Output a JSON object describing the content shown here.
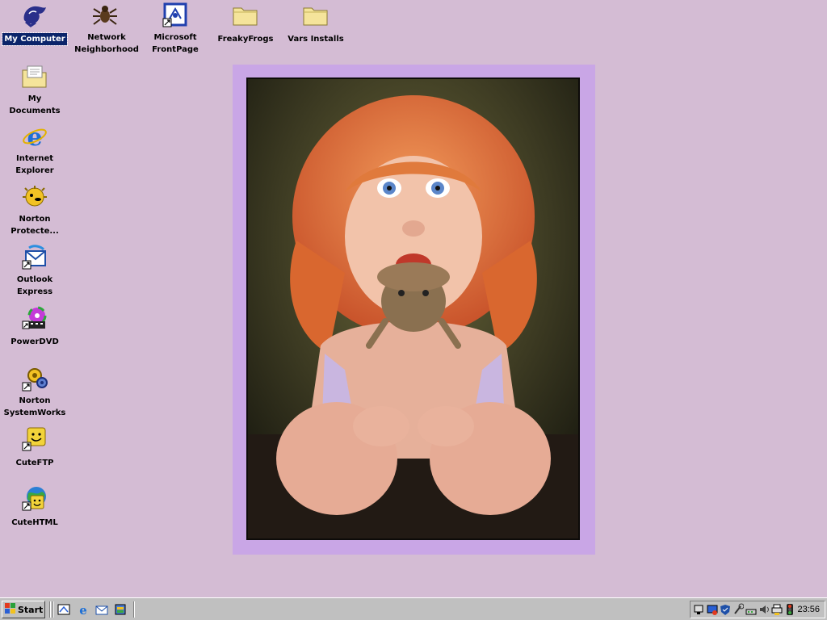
{
  "desktop": {
    "background": "#D4BCD4",
    "icons": [
      {
        "label": "My Computer",
        "icon": "my-computer-icon",
        "selected": true
      },
      {
        "label": "Network Neighborhood",
        "icon": "network-neighborhood-icon"
      },
      {
        "label": "Microsoft FrontPage",
        "icon": "frontpage-icon"
      },
      {
        "label": "FreakyFrogs",
        "icon": "folder-icon"
      },
      {
        "label": "Vars Installs",
        "icon": "folder-icon"
      },
      {
        "label": "My Documents",
        "icon": "my-documents-icon"
      },
      {
        "label": "Internet Explorer",
        "icon": "internet-explorer-icon"
      },
      {
        "label": "Norton Protecte...",
        "icon": "norton-protected-icon"
      },
      {
        "label": "Outlook Express",
        "icon": "outlook-express-icon"
      },
      {
        "label": "PowerDVD",
        "icon": "powerdvd-icon"
      },
      {
        "label": "Norton SystemWorks",
        "icon": "norton-systemworks-icon"
      },
      {
        "label": "CuteFTP",
        "icon": "cuteftp-icon"
      },
      {
        "label": "CuteHTML",
        "icon": "cutehtml-icon"
      }
    ]
  },
  "wallpaper": {
    "frame_color": "#C9A6E6",
    "subject": "child-with-frog-photo"
  },
  "taskbar": {
    "start_label": "Start",
    "quick_launch": [
      "show-desktop-icon",
      "internet-explorer-icon",
      "outlook-express-icon",
      "channels-icon"
    ],
    "tray_icons": [
      "network-tray-icon",
      "display-tray-icon",
      "shield-tray-icon",
      "tools-tray-icon",
      "modem-tray-icon",
      "volume-tray-icon",
      "printer-tray-icon",
      "traffic-light-tray-icon"
    ],
    "clock": "23:56"
  }
}
